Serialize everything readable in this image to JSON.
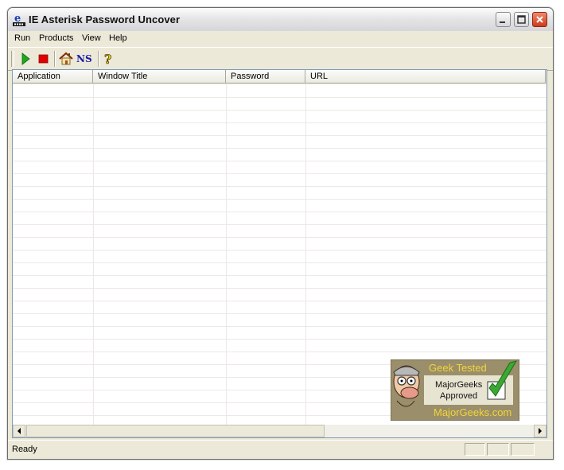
{
  "window": {
    "title": "IE Asterisk Password Uncover",
    "app_icon_letter": "e"
  },
  "menu": {
    "items": [
      {
        "label": "Run"
      },
      {
        "label": "Products"
      },
      {
        "label": "View"
      },
      {
        "label": "Help"
      }
    ]
  },
  "toolbar": {
    "ns_label": "NS",
    "help_label": "?",
    "icons": [
      "play-icon",
      "stop-icon",
      "home-icon",
      "ns-icon",
      "help-icon"
    ]
  },
  "list": {
    "columns": [
      {
        "label": "Application"
      },
      {
        "label": "Window Title"
      },
      {
        "label": "Password"
      },
      {
        "label": "URL"
      }
    ],
    "rows": []
  },
  "badge": {
    "line1": "Geek Tested",
    "line2": "MajorGeeks",
    "line3": "Approved",
    "line4": "MajorGeeks.com"
  },
  "status": {
    "text": "Ready"
  },
  "colors": {
    "play_green": "#1fa81f",
    "stop_red": "#e00000",
    "ns_blue": "#1a1aa6",
    "badge_gold": "#f2d43a",
    "badge_bg": "#9a8f6a",
    "check_green": "#3aa832"
  }
}
